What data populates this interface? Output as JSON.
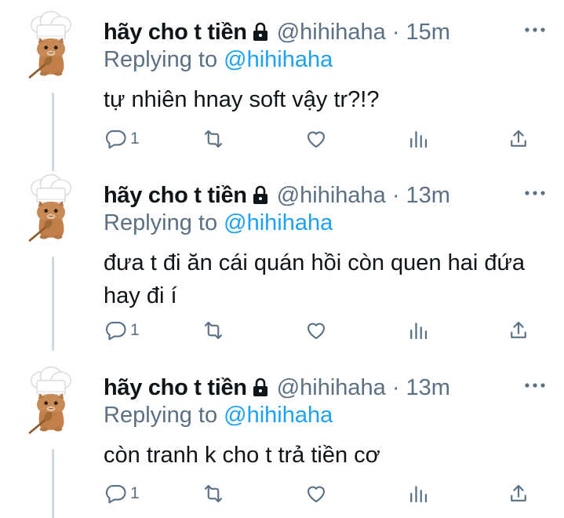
{
  "tweets": [
    {
      "display_name": "hãy cho t tiền",
      "handle": "@hihihaha",
      "dot": "·",
      "time": "15m",
      "replying_prefix": "Replying to",
      "replying_handle": "@hihihaha",
      "text": "tự nhiên hnay soft vậy tr?!?",
      "reply_count": "1"
    },
    {
      "display_name": "hãy cho t tiền",
      "handle": "@hihihaha",
      "dot": "·",
      "time": "13m",
      "replying_prefix": "Replying to",
      "replying_handle": "@hihihaha",
      "text": "đưa t đi ăn cái quán hồi còn quen hai đứa hay đi í",
      "reply_count": "1"
    },
    {
      "display_name": "hãy cho t tiền",
      "handle": "@hihihaha",
      "dot": "·",
      "time": "13m",
      "replying_prefix": "Replying to",
      "replying_handle": "@hihihaha",
      "text": "còn tranh k cho t trả tiền cơ",
      "reply_count": "1"
    }
  ],
  "colors": {
    "text": "#0f1419",
    "secondary": "#5b7083",
    "link": "#1da1f2",
    "thread_line": "#cfd9de"
  },
  "icons": [
    "lock-icon",
    "more-icon",
    "reply-icon",
    "retweet-icon",
    "like-icon",
    "views-icon",
    "share-icon",
    "chef-cat-avatar"
  ]
}
